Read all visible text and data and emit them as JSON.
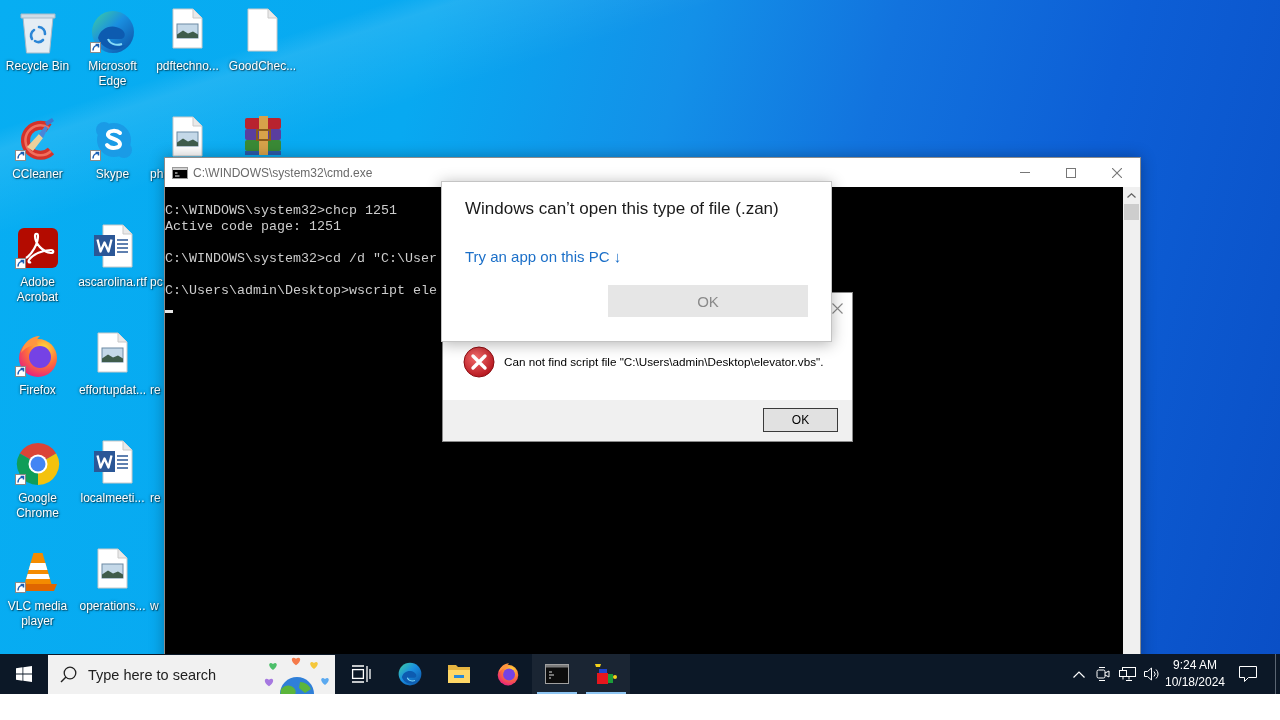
{
  "desktop_icons": [
    {
      "label": "Recycle Bin",
      "kind": "recycle-bin",
      "shortcut": false,
      "label_cut": false
    },
    {
      "label": "CCleaner",
      "kind": "ccleaner",
      "shortcut": true,
      "label_cut": false
    },
    {
      "label": "Adobe Acrobat",
      "kind": "acrobat",
      "shortcut": true,
      "label_cut": false
    },
    {
      "label": "Firefox",
      "kind": "firefox",
      "shortcut": true,
      "label_cut": false
    },
    {
      "label": "Google Chrome",
      "kind": "chrome",
      "shortcut": true,
      "label_cut": false
    },
    {
      "label": "VLC media player",
      "kind": "vlc",
      "shortcut": true,
      "label_cut": false
    },
    {
      "label": "Microsoft Edge",
      "kind": "edge",
      "shortcut": true,
      "label_cut": false
    },
    {
      "label": "Skype",
      "kind": "skype",
      "shortcut": true,
      "label_cut": false
    },
    {
      "label": "ascarolina.rtf",
      "kind": "word-doc",
      "shortcut": false,
      "label_cut": false
    },
    {
      "label": "effortupdat...",
      "kind": "image-file",
      "shortcut": false,
      "label_cut": false
    },
    {
      "label": "localmeeti...",
      "kind": "word-doc",
      "shortcut": false,
      "label_cut": false
    },
    {
      "label": "operations...",
      "kind": "image-file",
      "shortcut": false,
      "label_cut": false
    },
    {
      "label": "pdftechno...",
      "kind": "image-file",
      "shortcut": false,
      "label_cut": false
    },
    {
      "label": "ph",
      "kind": "image-file",
      "shortcut": false,
      "label_cut": true
    },
    {
      "label": "pc",
      "kind": "covered",
      "shortcut": false,
      "label_cut": true
    },
    {
      "label": "re",
      "kind": "covered",
      "shortcut": false,
      "label_cut": true
    },
    {
      "label": "re",
      "kind": "covered",
      "shortcut": false,
      "label_cut": true
    },
    {
      "label": "w",
      "kind": "covered",
      "shortcut": false,
      "label_cut": true
    },
    {
      "label": "GoodChec...",
      "kind": "blank-file",
      "shortcut": false,
      "label_cut": false
    },
    {
      "kind": "winrar"
    }
  ],
  "cmd_window": {
    "title": "C:\\WINDOWS\\system32\\cmd.exe",
    "blocks": [
      {
        "lines": [
          "C:\\WINDOWS\\system32>chcp 1251",
          "Active code page: 1251"
        ]
      },
      {
        "lines": [
          "C:\\WINDOWS\\system32>cd /d \"C:\\User"
        ]
      },
      {
        "lines": [
          "C:\\Users\\admin\\Desktop>wscript ele"
        ]
      }
    ],
    "cursor_visible": true
  },
  "script_error_dialog": {
    "message": "Can not find script file \"C:\\Users\\admin\\Desktop\\elevator.vbs\".",
    "button": {
      "label": "OK"
    }
  },
  "open_with_dialog": {
    "title": "Windows can’t open this type of file (.zan)",
    "link": "Try an app on this PC ↓",
    "button": {
      "label": "OK",
      "disabled": true
    }
  },
  "taskbar": {
    "search_placeholder": "Type here to search",
    "apps": [
      {
        "kind": "task-view",
        "running": false
      },
      {
        "kind": "edge",
        "running": false
      },
      {
        "kind": "explorer",
        "running": false
      },
      {
        "kind": "firefox",
        "running": false
      },
      {
        "kind": "terminal",
        "running": true
      },
      {
        "kind": "blocks",
        "running": true
      }
    ],
    "clock": {
      "time": "9:24 AM",
      "date": "10/18/2024"
    }
  }
}
